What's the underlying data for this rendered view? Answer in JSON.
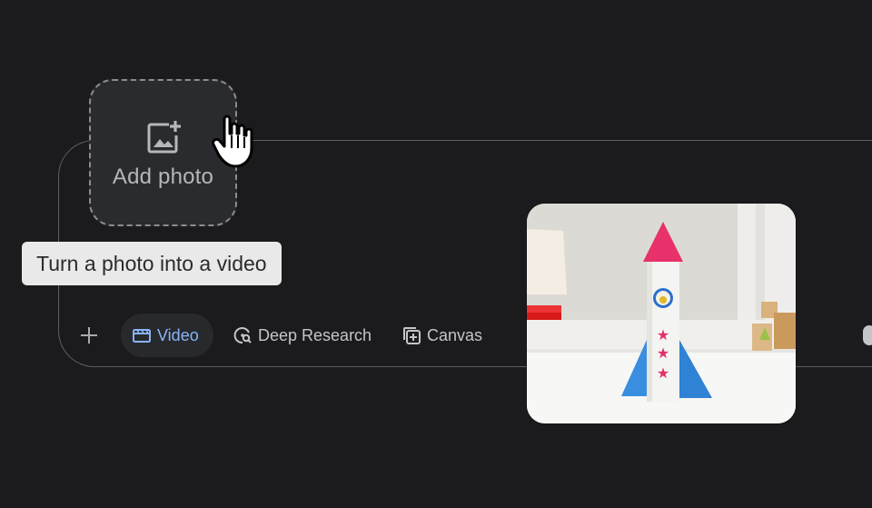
{
  "add_photo": {
    "label": "Add photo",
    "icon": "add-photo-icon"
  },
  "tooltip": {
    "text": "Turn a photo into a video"
  },
  "toolbar": {
    "plus_icon": "plus-icon",
    "chips": [
      {
        "label": "Video",
        "icon": "video-clapper-icon",
        "active": true
      },
      {
        "label": "Deep Research",
        "icon": "deep-research-icon",
        "active": false
      },
      {
        "label": "Canvas",
        "icon": "canvas-icon",
        "active": false
      }
    ],
    "mic_icon": "microphone-icon"
  },
  "photo": {
    "subject": "paper rocket toy"
  },
  "colors": {
    "background": "#1b1b1d",
    "accent_blue": "#8ab4f8",
    "tooltip_bg": "#e9e9ea",
    "border": "#5d5e61"
  }
}
